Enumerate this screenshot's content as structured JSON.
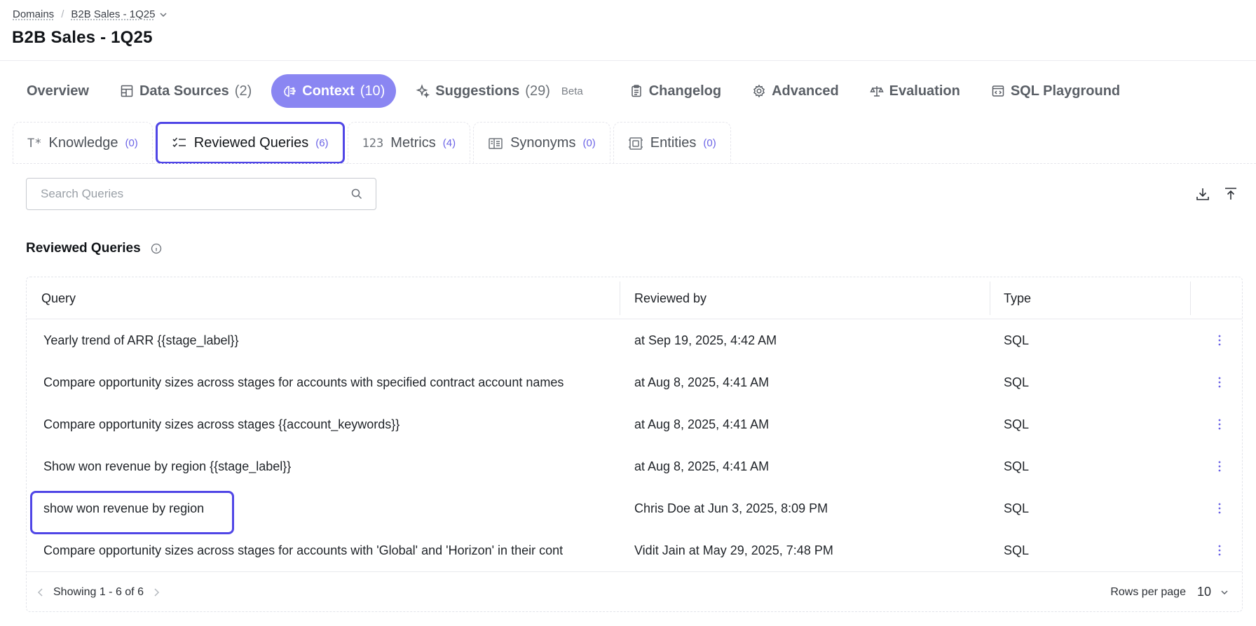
{
  "breadcrumb": {
    "root": "Domains",
    "current": "B2B Sales - 1Q25"
  },
  "page": {
    "title": "B2B Sales - 1Q25"
  },
  "main_tabs": [
    {
      "label": "Overview",
      "count": "",
      "icon": "none"
    },
    {
      "label": "Data Sources",
      "count": "(2)",
      "icon": "table-icon"
    },
    {
      "label": "Context",
      "count": "(10)",
      "icon": "brain-icon",
      "active": true
    },
    {
      "label": "Suggestions",
      "count": "(29)",
      "icon": "sparkle-icon",
      "badge": "Beta"
    },
    {
      "label": "Changelog",
      "count": "",
      "icon": "clipboard-icon"
    },
    {
      "label": "Advanced",
      "count": "",
      "icon": "gear-icon"
    },
    {
      "label": "Evaluation",
      "count": "",
      "icon": "scale-icon"
    },
    {
      "label": "SQL Playground",
      "count": "",
      "icon": "code-window-icon"
    }
  ],
  "sub_tabs": [
    {
      "label": "Knowledge",
      "count": "(0)",
      "glyph": "T*"
    },
    {
      "label": "Reviewed Queries",
      "count": "(6)",
      "icon": "checklist-icon",
      "active": true
    },
    {
      "label": "Metrics",
      "count": "(4)",
      "glyph": "123"
    },
    {
      "label": "Synonyms",
      "count": "(0)",
      "icon": "synonyms-icon"
    },
    {
      "label": "Entities",
      "count": "(0)",
      "icon": "entity-icon"
    }
  ],
  "search": {
    "placeholder": "Search Queries",
    "value": ""
  },
  "section": {
    "title": "Reviewed Queries"
  },
  "table": {
    "columns": [
      "Query",
      "Reviewed by",
      "Type"
    ],
    "rows": [
      {
        "query": "Yearly trend of ARR {{stage_label}}",
        "reviewed_by": "at Sep 19, 2025, 4:42 AM",
        "type": "SQL"
      },
      {
        "query": "Compare opportunity sizes across stages for accounts with specified contract account names",
        "reviewed_by": "at Aug 8, 2025, 4:41 AM",
        "type": "SQL"
      },
      {
        "query": "Compare opportunity sizes across stages {{account_keywords}}",
        "reviewed_by": "at Aug 8, 2025, 4:41 AM",
        "type": "SQL"
      },
      {
        "query": "Show won revenue by region {{stage_label}}",
        "reviewed_by": "at Aug 8, 2025, 4:41 AM",
        "type": "SQL"
      },
      {
        "query": "show won revenue by region",
        "reviewed_by": "Chris Doe at Jun 3, 2025, 8:09 PM",
        "type": "SQL",
        "highlighted": true
      },
      {
        "query": "Compare opportunity sizes across stages for accounts with 'Global' and 'Horizon' in their cont",
        "reviewed_by": "Vidit Jain at May 29, 2025, 7:48 PM",
        "type": "SQL"
      }
    ]
  },
  "footer": {
    "showing": "Showing 1 - 6 of 6",
    "rows_per_page_label": "Rows per page",
    "rows_per_page_value": "10"
  },
  "colors": {
    "accent": "#8a86f2",
    "highlight": "#5046e6",
    "count_text": "#6b63e6"
  }
}
